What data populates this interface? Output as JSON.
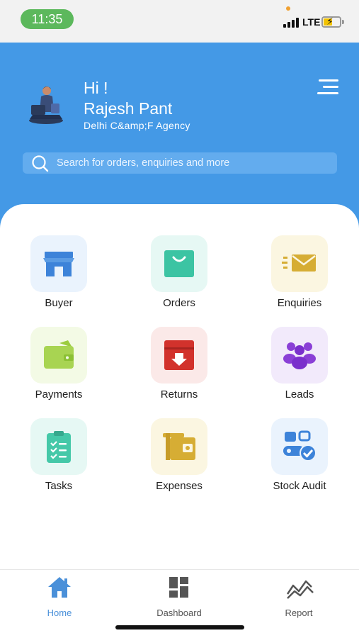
{
  "status_bar": {
    "time": "11:35",
    "network": "LTE",
    "battery_color": "#f2c200"
  },
  "header": {
    "greeting": "Hi !",
    "user_name": "Rajesh Pant",
    "agency": "Delhi C&amp;F Agency",
    "avatar_icon": "user-sitting-laptop-icon",
    "menu_icon": "menu-icon",
    "background_color": "#4499e6"
  },
  "search": {
    "placeholder": "Search for orders, enquiries and more"
  },
  "tiles": [
    {
      "label": "Buyer",
      "icon": "store-icon"
    },
    {
      "label": "Orders",
      "icon": "shopping-bag-icon"
    },
    {
      "label": "Enquiries",
      "icon": "envelope-icon"
    },
    {
      "label": "Payments",
      "icon": "wallet-icon"
    },
    {
      "label": "Returns",
      "icon": "return-box-icon"
    },
    {
      "label": "Leads",
      "icon": "group-icon"
    },
    {
      "label": "Tasks",
      "icon": "clipboard-checklist-icon"
    },
    {
      "label": "Expenses",
      "icon": "expense-wallet-icon"
    },
    {
      "label": "Stock Audit",
      "icon": "stock-audit-icon"
    }
  ],
  "bottom_nav": [
    {
      "label": "Home",
      "icon": "home-icon",
      "active": true
    },
    {
      "label": "Dashboard",
      "icon": "dashboard-icon",
      "active": false
    },
    {
      "label": "Report",
      "icon": "report-chart-icon",
      "active": false
    }
  ],
  "colors": {
    "active_nav": "#4a90d9",
    "inactive_nav": "#555555"
  }
}
